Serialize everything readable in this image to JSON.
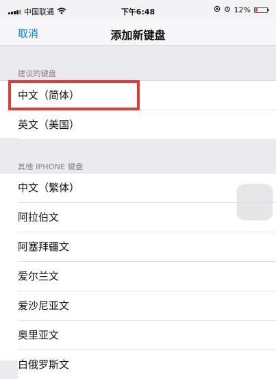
{
  "status_bar": {
    "carrier": "中国联通",
    "time": "下午6:48",
    "battery_percent": "12%"
  },
  "nav": {
    "cancel_label": "取消",
    "title": "添加新键盘"
  },
  "suggested": {
    "header": "建议的键盘",
    "items": [
      {
        "label": "中文（简体）"
      },
      {
        "label": "英文（美国）"
      }
    ]
  },
  "other": {
    "header": "其他 IPHONE 键盘",
    "items": [
      {
        "label": "中文（繁体）"
      },
      {
        "label": "阿拉伯文"
      },
      {
        "label": "阿塞拜疆文"
      },
      {
        "label": "爱尔兰文"
      },
      {
        "label": "爱沙尼亚文"
      },
      {
        "label": "奥里亚文"
      },
      {
        "label": "白俄罗斯文"
      }
    ]
  },
  "colors": {
    "accent": "#007aff",
    "highlight": "#e53935",
    "background": "#ebebef"
  },
  "icons": [
    "signal-icon",
    "wifi-icon",
    "lock-rotation-icon",
    "alarm-icon",
    "battery-icon",
    "assistive-touch-icon"
  ]
}
